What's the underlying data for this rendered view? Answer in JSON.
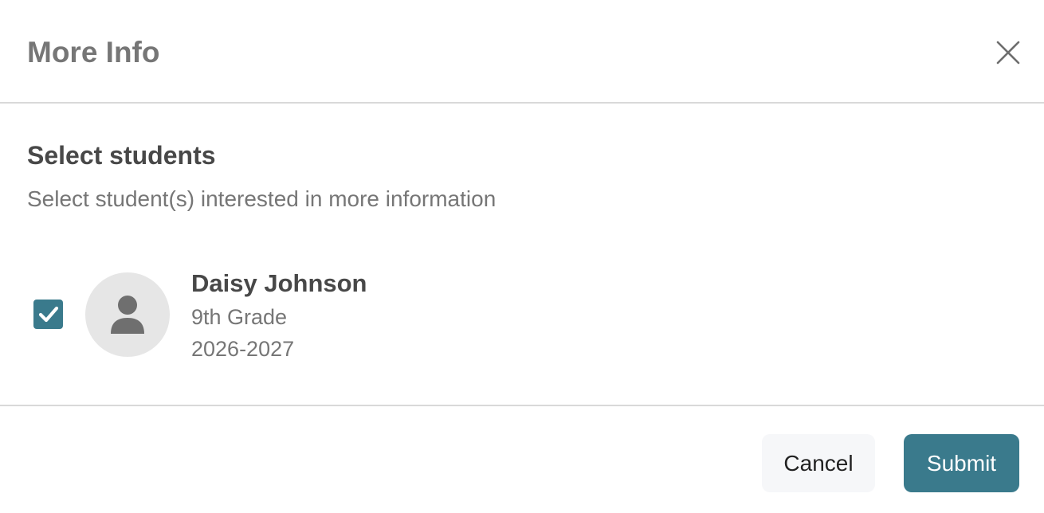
{
  "header": {
    "title": "More Info",
    "close_icon": "close-icon"
  },
  "body": {
    "section_title": "Select students",
    "section_subtitle": "Select student(s) interested in more information",
    "students": [
      {
        "name": "Daisy Johnson",
        "grade": "9th Grade",
        "year": "2026-2027",
        "checked": true,
        "avatar_icon": "person-icon"
      }
    ]
  },
  "footer": {
    "cancel_label": "Cancel",
    "submit_label": "Submit"
  },
  "colors": {
    "accent": "#3a7a8c",
    "title": "#767676",
    "text_dark": "#484848",
    "text_muted": "#767676",
    "divider": "#d9d9d9",
    "cancel_bg": "#f6f7f9",
    "avatar_bg": "#e6e6e6"
  }
}
